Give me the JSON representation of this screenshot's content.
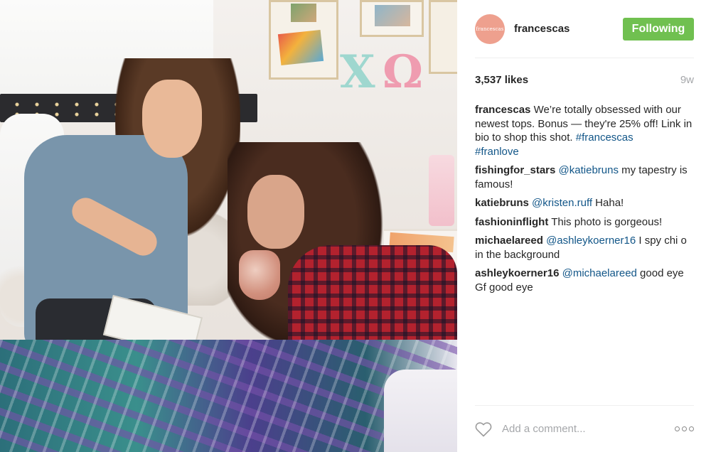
{
  "header": {
    "avatar_text": "francescas",
    "username": "francescas",
    "follow_label": "Following"
  },
  "stats": {
    "likes": "3,537 likes",
    "time_ago": "9w"
  },
  "caption": {
    "author": "francescas",
    "text": " We’re totally obsessed with our newest tops. Bonus — they're 25% off! Link in bio to shop this shot. ",
    "hashtag1": "#francescas",
    "hashtag2": "#franlove"
  },
  "comments": [
    {
      "author": "fishingfor_stars",
      "mention": "@katiebruns",
      "text": " my tapestry is famous!"
    },
    {
      "author": "katiebruns",
      "mention": "@kristen.ruff",
      "text": " Haha!"
    },
    {
      "author": "fashioninflight",
      "mention": "",
      "text": " This photo is gorgeous!"
    },
    {
      "author": "michaelareed",
      "mention": "@ashleykoerner16",
      "text": " I spy chi o in the background"
    },
    {
      "author": "ashleykoerner16",
      "mention": "@michaelareed",
      "text": " good eye Gf good eye"
    }
  ],
  "footer": {
    "comment_placeholder": "Add a comment..."
  },
  "colors": {
    "follow_green": "#70c050",
    "link_blue": "#125688",
    "avatar_pink": "#eea08e",
    "muted_gray": "#a5a7aa"
  },
  "icons": [
    "heart-icon",
    "more-options-icon"
  ]
}
